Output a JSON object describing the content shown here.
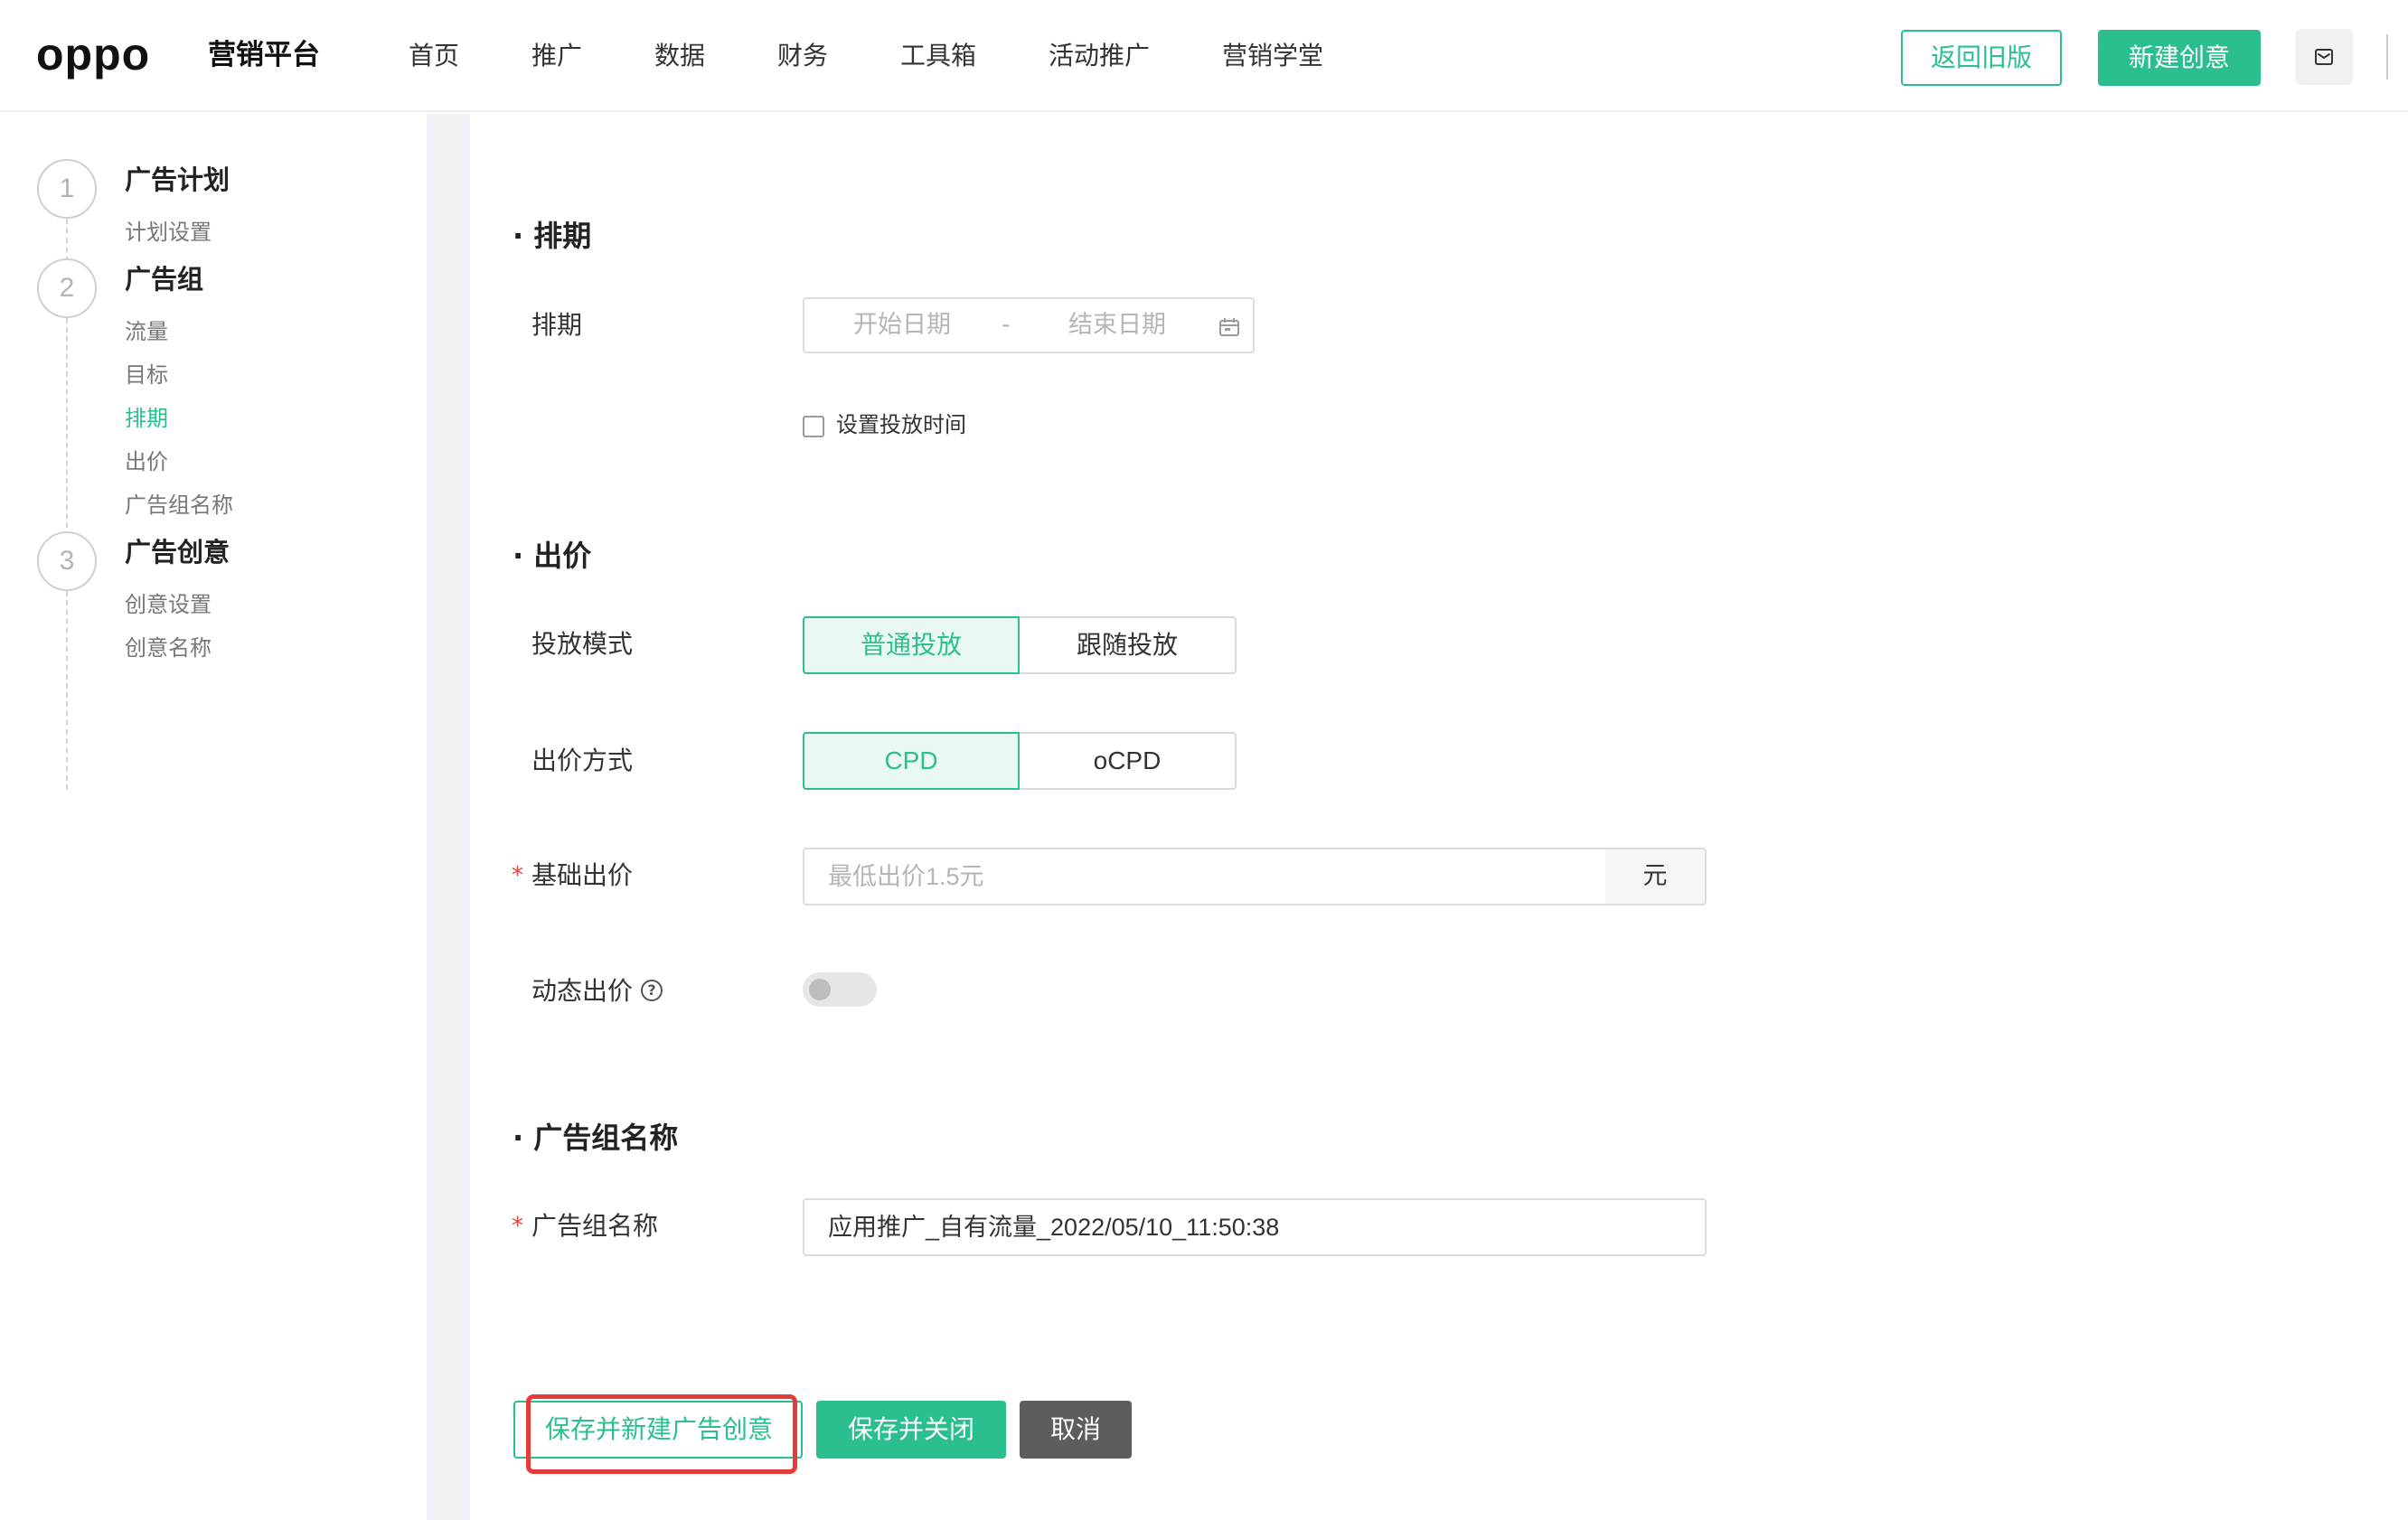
{
  "header": {
    "logo": "oppo",
    "platform_name": "营销平台",
    "nav": [
      "首页",
      "推广",
      "数据",
      "财务",
      "工具箱",
      "活动推广",
      "营销学堂"
    ],
    "back_old_label": "返回旧版",
    "new_creative_label": "新建创意",
    "message_icon": "mail-icon"
  },
  "sidebar": {
    "steps": [
      {
        "number": "1",
        "title": "广告计划",
        "items": [
          "计划设置"
        ]
      },
      {
        "number": "2",
        "title": "广告组",
        "items": [
          "流量",
          "目标",
          "排期",
          "出价",
          "广告组名称"
        ]
      },
      {
        "number": "3",
        "title": "广告创意",
        "items": [
          "创意设置",
          "创意名称"
        ]
      }
    ],
    "active_item": "排期"
  },
  "schedule": {
    "section_title": "排期",
    "field_label": "排期",
    "start_placeholder": "开始日期",
    "separator": "-",
    "end_placeholder": "结束日期",
    "calendar_icon": "calendar-icon",
    "time_checkbox_label": "设置投放时间",
    "time_checkbox_checked": false
  },
  "bid": {
    "section_title": "出价",
    "mode_label": "投放模式",
    "mode_options": [
      "普通投放",
      "跟随投放"
    ],
    "mode_selected": "普通投放",
    "method_label": "出价方式",
    "method_options": [
      "CPD",
      "oCPD"
    ],
    "method_selected": "CPD",
    "base_bid_label": "基础出价",
    "base_bid_required": true,
    "base_bid_placeholder": "最低出价1.5元",
    "base_bid_unit": "元",
    "dynamic_bid_label": "动态出价",
    "dynamic_bid_on": false
  },
  "group_name": {
    "section_title": "广告组名称",
    "field_label": "广告组名称",
    "required": true,
    "value": "应用推广_自有流量_2022/05/10_11:50:38"
  },
  "actions": {
    "save_and_new_label": "保存并新建广告创意",
    "save_and_close_label": "保存并关闭",
    "cancel_label": "取消"
  },
  "colors": {
    "primary": "#2bbf8f",
    "highlight": "#e63b3b",
    "required": "#e8453c",
    "cancel": "#5d5d5d"
  }
}
